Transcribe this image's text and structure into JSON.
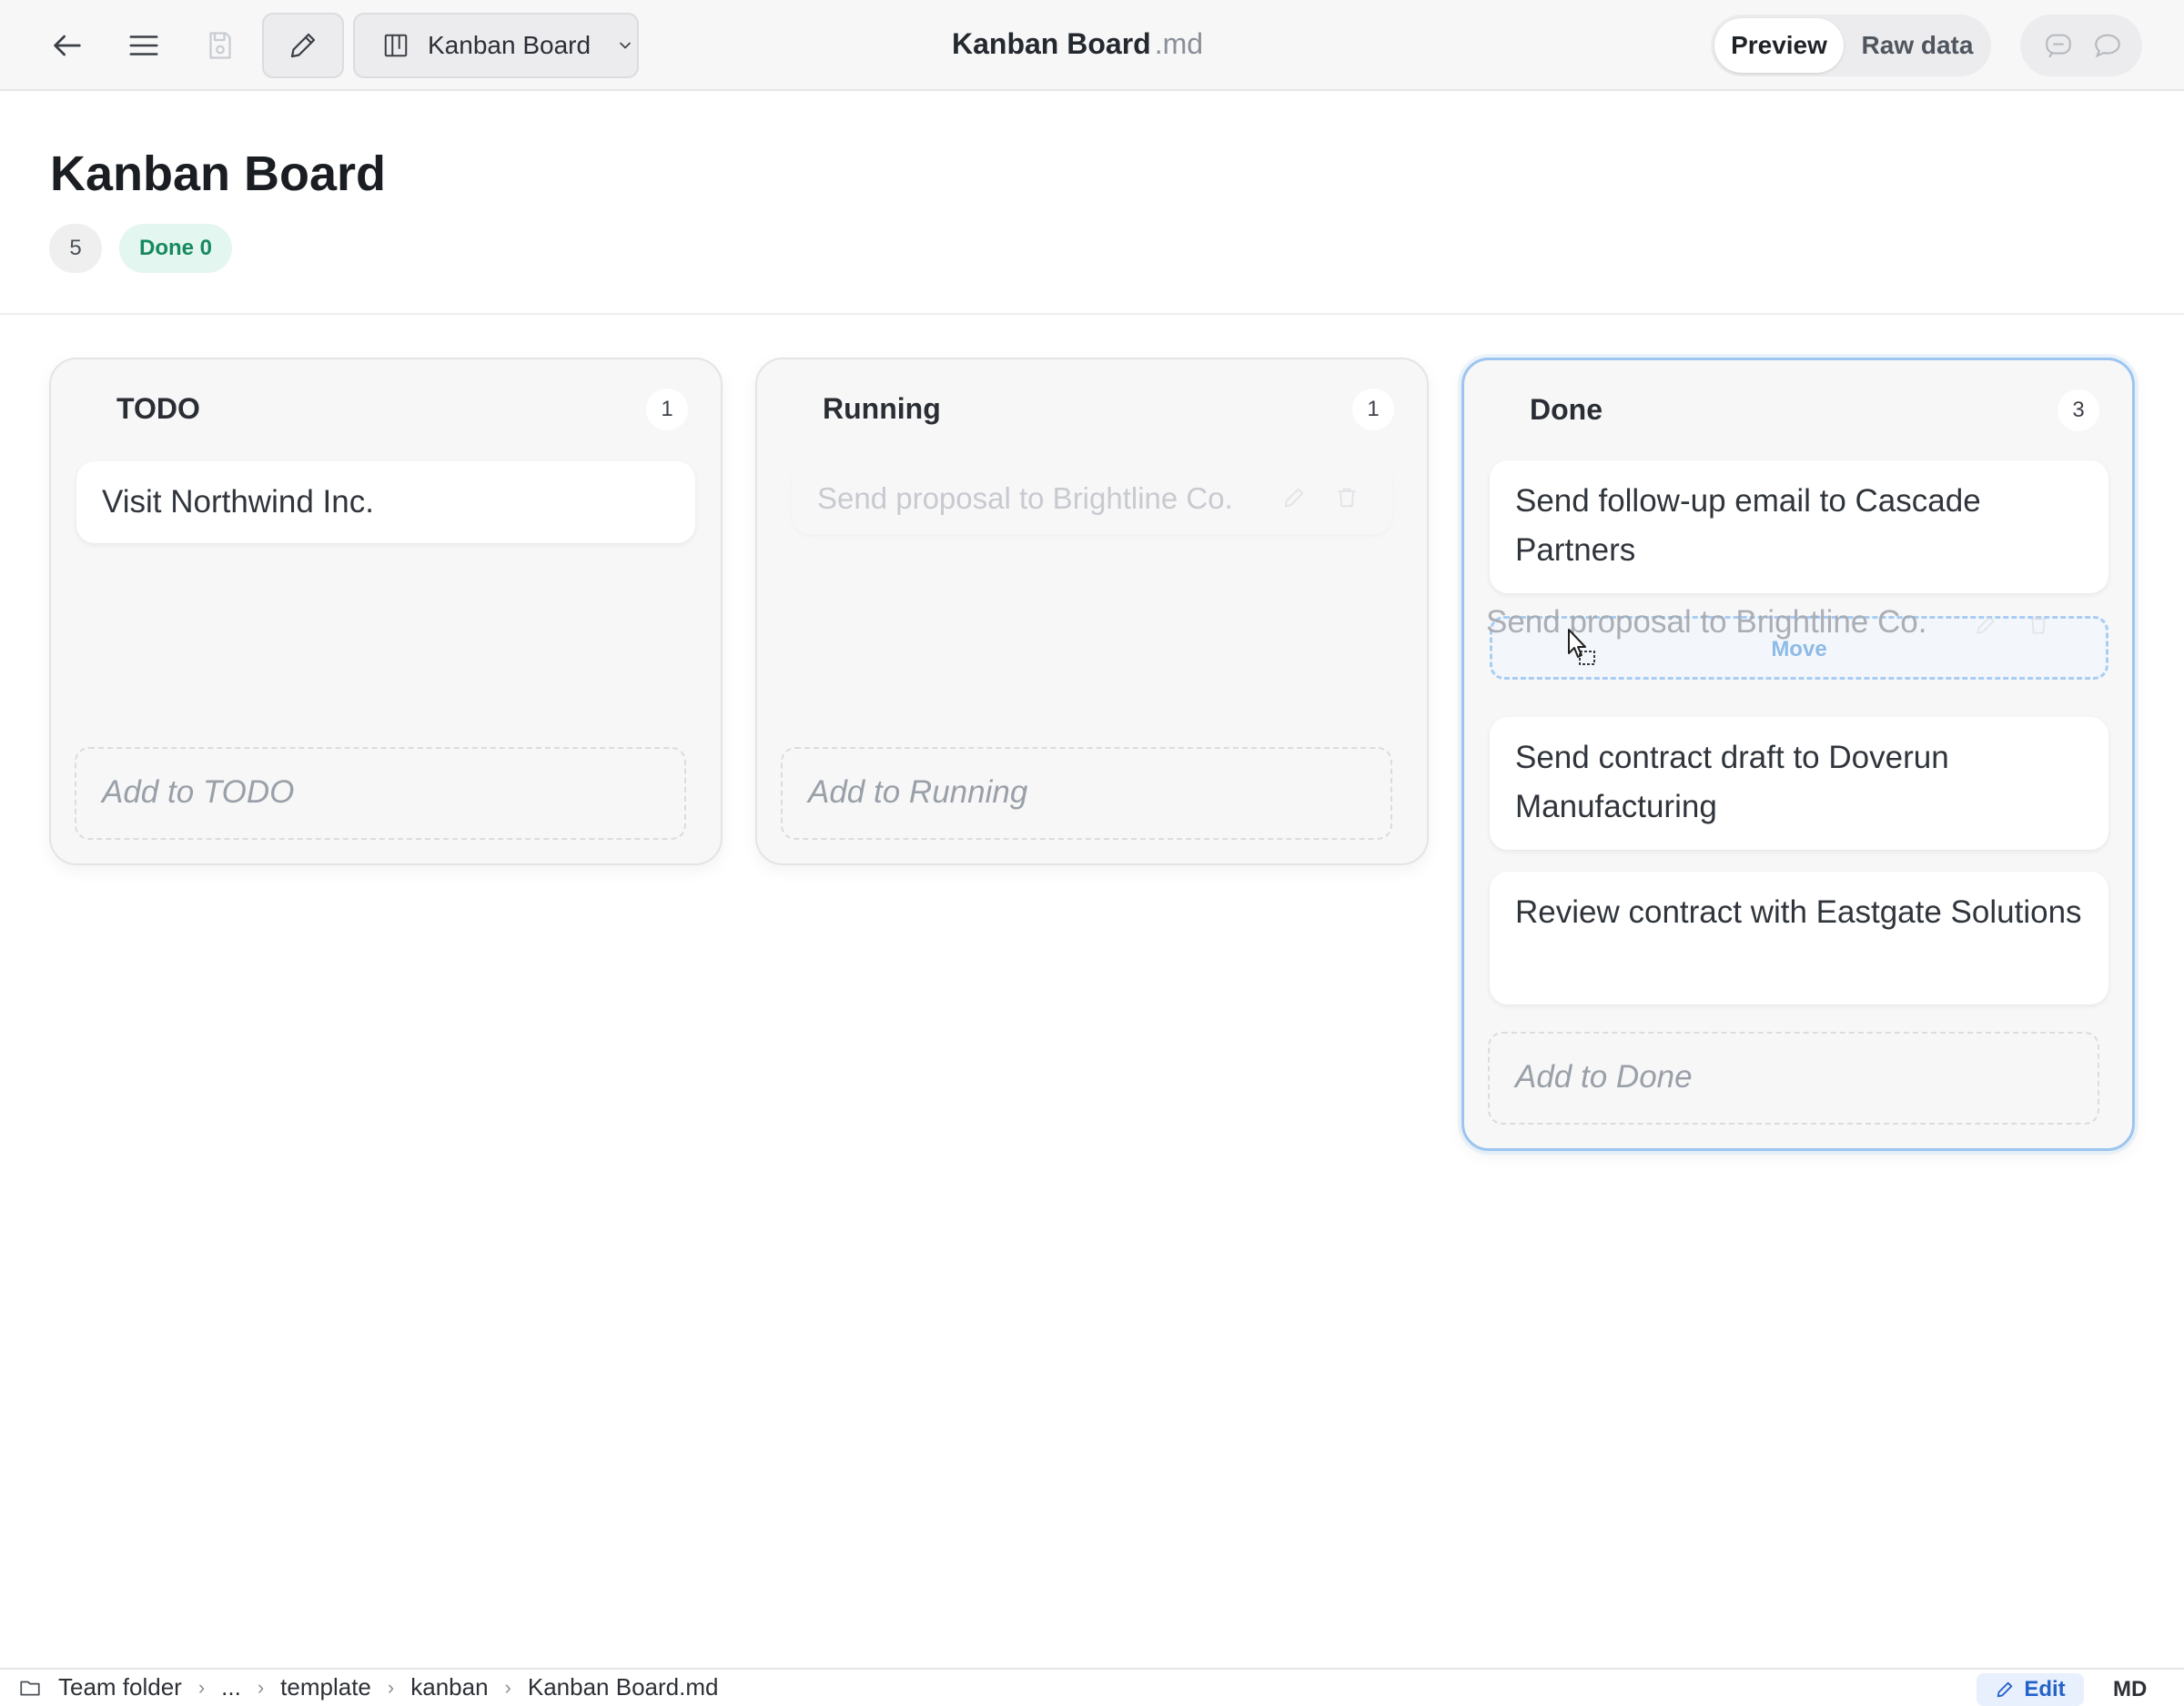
{
  "toolbar": {
    "view_select_label": "Kanban Board",
    "doc_title": "Kanban Board",
    "doc_ext": ".md",
    "preview_label": "Preview",
    "raw_label": "Raw data"
  },
  "header": {
    "title": "Kanban Board",
    "total_count": "5",
    "done_badge": "Done 0"
  },
  "columns": [
    {
      "title": "TODO",
      "count": "1",
      "cards": [
        "Visit Northwind Inc."
      ],
      "add_label": "Add to TODO"
    },
    {
      "title": "Running",
      "count": "1",
      "cards": [
        "Send proposal to Brightline Co."
      ],
      "add_label": "Add to Running"
    },
    {
      "title": "Done",
      "count": "3",
      "cards": [
        "Send follow-up email to Cascade Partners",
        "Send contract draft to Doverun Manufacturing",
        "Review contract with Eastgate Solutions"
      ],
      "add_label": "Add to Done"
    }
  ],
  "drag": {
    "preview_text": "Send proposal to Brightline Co.",
    "drop_label": "Move"
  },
  "statusbar": {
    "breadcrumb": [
      "Team folder",
      "...",
      "template",
      "kanban",
      "Kanban Board.md"
    ],
    "edit_label": "Edit",
    "format_label": "MD"
  },
  "colors": {
    "accent_blue": "#2563c9",
    "done_green": "#17895f",
    "drop_outline": "#a9cdf2"
  },
  "icons": {
    "back": "arrow-left-icon",
    "menu": "hamburger-icon",
    "save": "save-icon",
    "edit": "pencil-icon",
    "view": "board-icon",
    "chat": "chat-icon",
    "folder": "folder-icon"
  }
}
